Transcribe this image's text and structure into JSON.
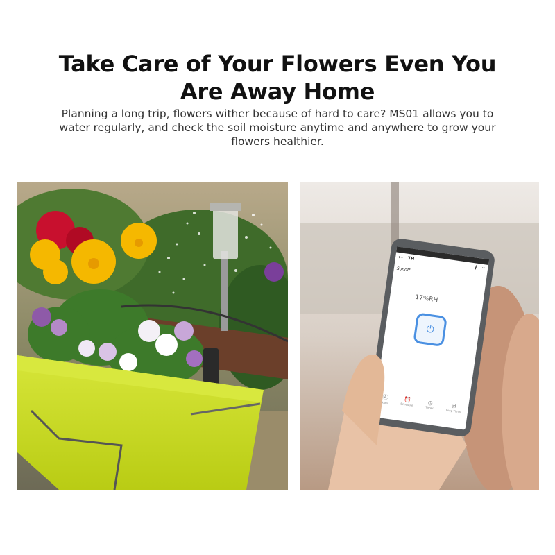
{
  "headline": {
    "line1": "Take Care of Your Flowers Even You",
    "line2": "Are Away Home"
  },
  "subtext": {
    "line1": "Planning a long trip, flowers wither because of hard to care? MS01 allows you to",
    "line2": "water regularly, and check the soil moisture anytime and anywhere to grow your",
    "line3": "flowers healthier."
  },
  "phone_app": {
    "back_icon": "arrow-left-icon",
    "title": "TH",
    "info_icon": "info-icon",
    "more_icon": "more-icon",
    "brand": "Sonoff",
    "reading": "17%RH",
    "power_icon": "power-icon",
    "nav": [
      {
        "label": "Auto",
        "icon": "auto-icon"
      },
      {
        "label": "Schedule",
        "icon": "alarm-clock-icon"
      },
      {
        "label": "Timer",
        "icon": "timer-icon"
      },
      {
        "label": "Loop Timer",
        "icon": "loop-icon"
      }
    ]
  },
  "colors": {
    "planter": "#c9dd1f",
    "power_button": "#4a90e2",
    "flowers_yellow": "#f5b800",
    "flowers_purple": "#b489c8"
  }
}
